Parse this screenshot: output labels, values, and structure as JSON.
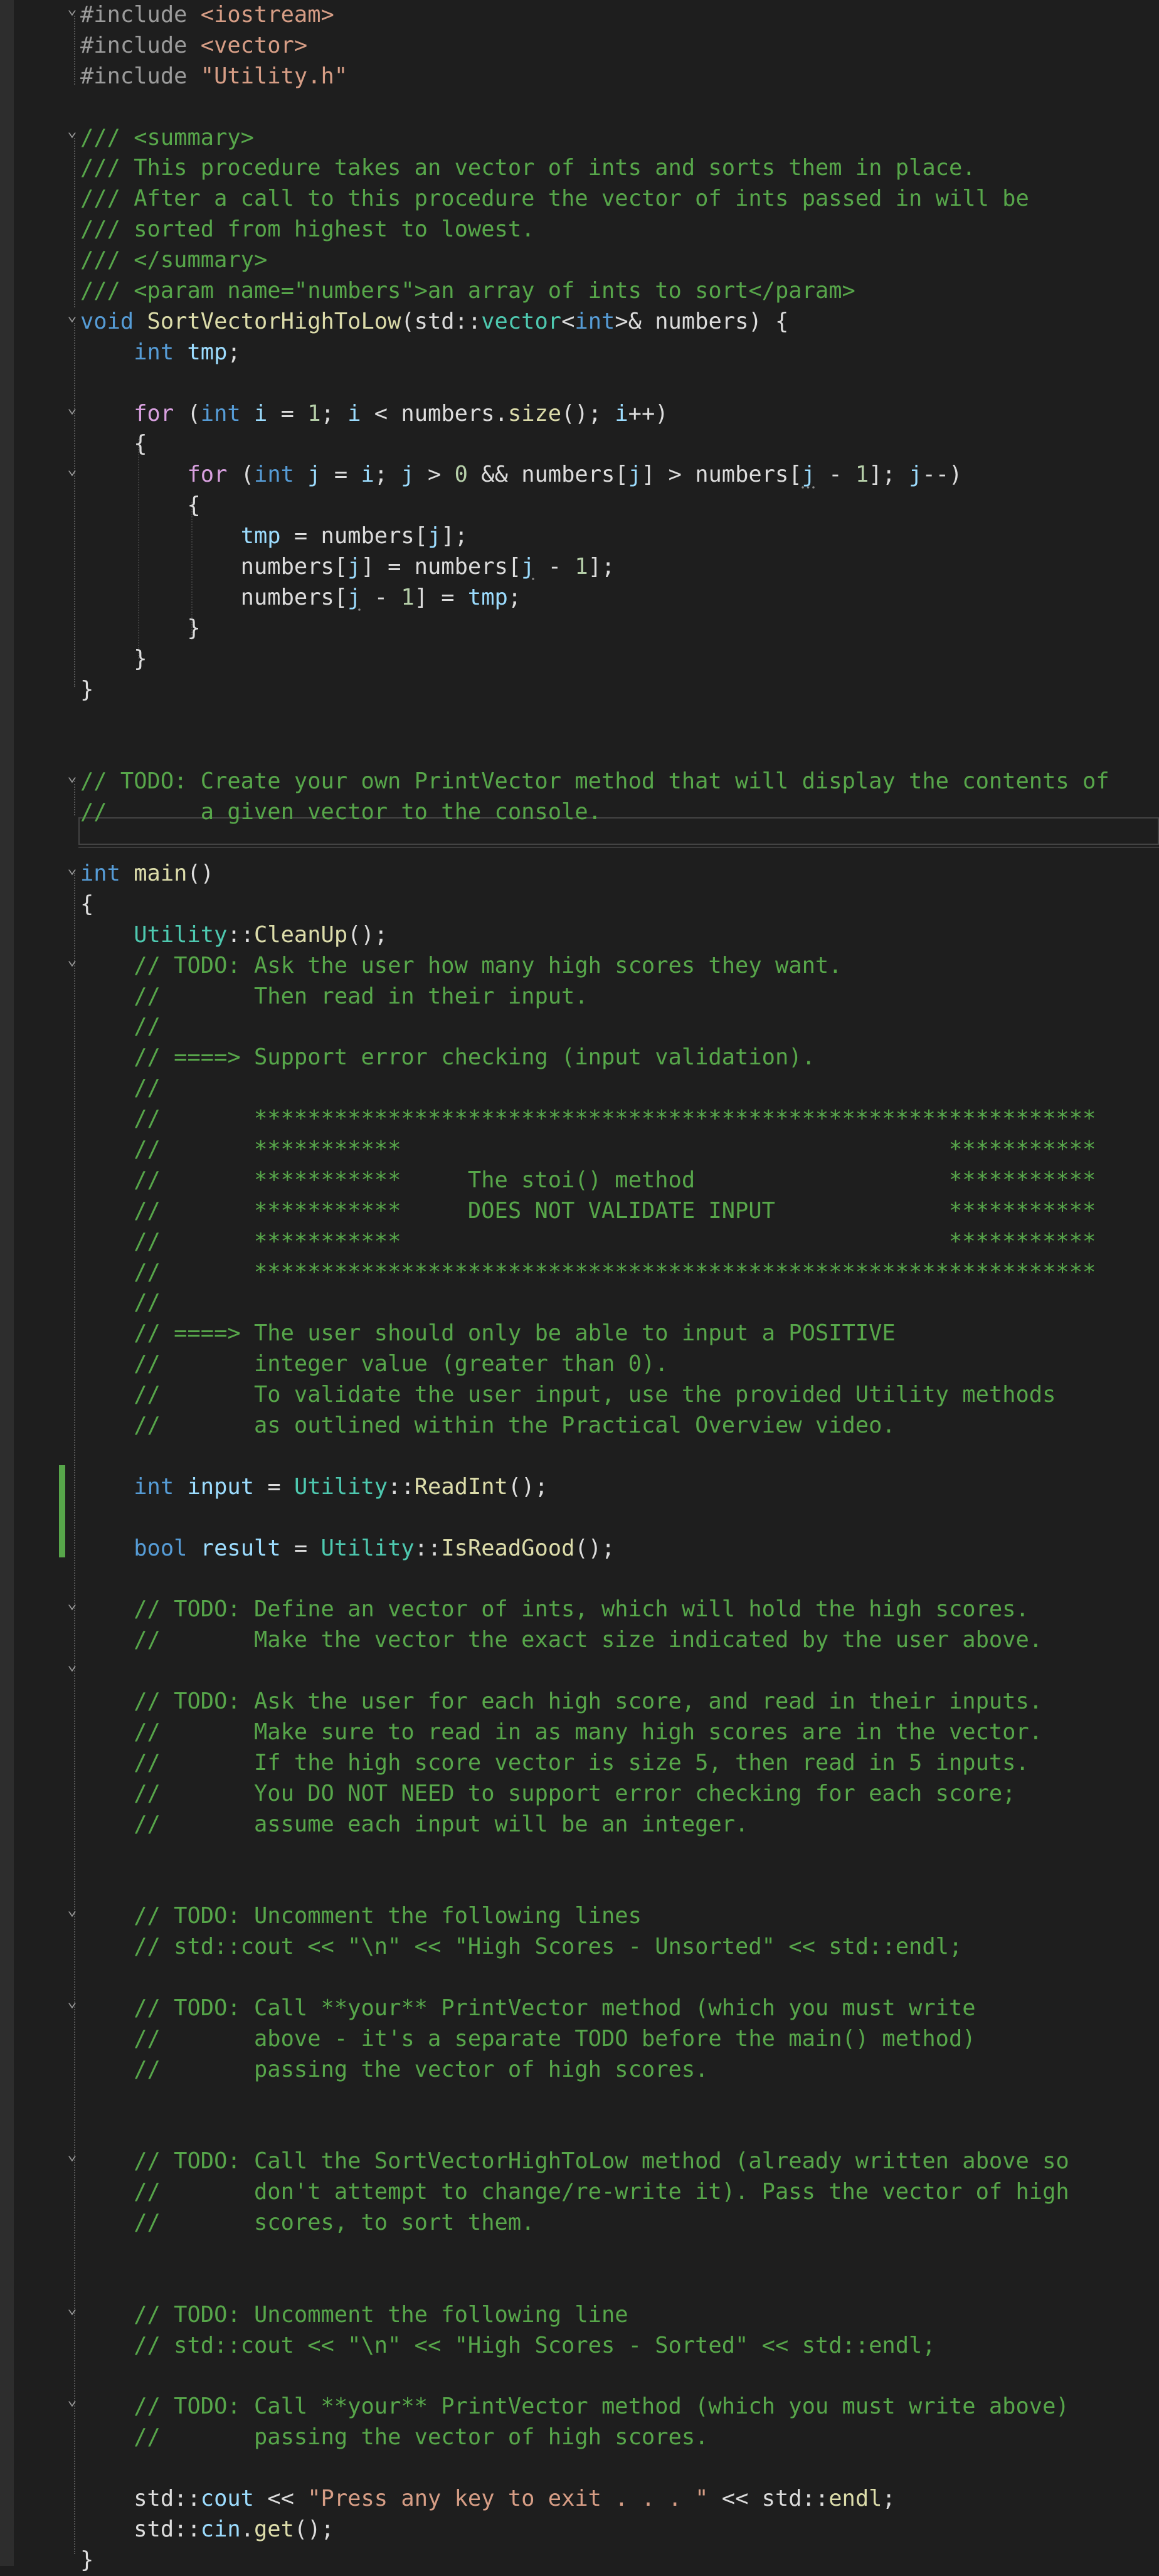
{
  "editor": {
    "language": "C++",
    "colors": {
      "background": "#1e1e1e",
      "keyword": "#569cd6",
      "comment": "#57a64a",
      "string": "#d69d85",
      "function": "#dcdcaa",
      "variable": "#9cdcfe",
      "type": "#4ec9b0",
      "number": "#b5cea8",
      "change_bar": "#57a64a"
    },
    "lines": [
      [
        [
          "pp",
          "#include "
        ],
        [
          "str",
          "<iostream>"
        ]
      ],
      [
        [
          "pp",
          "#include "
        ],
        [
          "str",
          "<vector>"
        ]
      ],
      [
        [
          "pp",
          "#include "
        ],
        [
          "str",
          "\"Utility.h\""
        ]
      ],
      [],
      [
        [
          "doc",
          "/// <summary>"
        ]
      ],
      [
        [
          "doc",
          "/// This procedure takes an vector of ints and sorts them in place."
        ]
      ],
      [
        [
          "doc",
          "/// After a call to this procedure the vector of ints passed in will be"
        ]
      ],
      [
        [
          "doc",
          "/// sorted from highest to lowest."
        ]
      ],
      [
        [
          "doc",
          "/// </summary>"
        ]
      ],
      [
        [
          "doc",
          "/// <param name=\"numbers\">an array of ints to sort</param>"
        ]
      ],
      [
        [
          "kw",
          "void "
        ],
        [
          "fn",
          "SortVectorHighToLow"
        ],
        [
          "text",
          "(std::"
        ],
        [
          "type",
          "vector"
        ],
        [
          "text",
          "<"
        ],
        [
          "kw",
          "int"
        ],
        [
          "text",
          ">& numbers) {"
        ]
      ],
      [
        [
          "text",
          "    "
        ],
        [
          "kw",
          "int "
        ],
        [
          "var",
          "tmp"
        ],
        [
          "text",
          ";"
        ]
      ],
      [],
      [
        [
          "text",
          "    "
        ],
        [
          "kw2",
          "for "
        ],
        [
          "text",
          "("
        ],
        [
          "kw",
          "int "
        ],
        [
          "var",
          "i"
        ],
        [
          "text",
          " = "
        ],
        [
          "num",
          "1"
        ],
        [
          "text",
          "; "
        ],
        [
          "var",
          "i"
        ],
        [
          "text",
          " < numbers."
        ],
        [
          "fn",
          "size"
        ],
        [
          "text",
          "(); "
        ],
        [
          "var",
          "i"
        ],
        [
          "text",
          "++)"
        ]
      ],
      [
        [
          "text",
          "    {"
        ]
      ],
      [
        [
          "text",
          "        "
        ],
        [
          "kw2",
          "for "
        ],
        [
          "text",
          "("
        ],
        [
          "kw",
          "int "
        ],
        [
          "var",
          "j"
        ],
        [
          "text",
          " = "
        ],
        [
          "var",
          "i"
        ],
        [
          "text",
          "; "
        ],
        [
          "var",
          "j"
        ],
        [
          "text",
          " > "
        ],
        [
          "num",
          "0"
        ],
        [
          "text",
          " && numbers["
        ],
        [
          "var",
          "j"
        ],
        [
          "text",
          "] > numbers["
        ],
        [
          "varsq",
          "j"
        ],
        [
          "text",
          " - "
        ],
        [
          "num",
          "1"
        ],
        [
          "text",
          "]; "
        ],
        [
          "var",
          "j"
        ],
        [
          "text",
          "--)"
        ]
      ],
      [
        [
          "text",
          "        {"
        ]
      ],
      [
        [
          "text",
          "            "
        ],
        [
          "var",
          "tmp"
        ],
        [
          "text",
          " = numbers["
        ],
        [
          "var",
          "j"
        ],
        [
          "text",
          "];"
        ]
      ],
      [
        [
          "text",
          "            numbers["
        ],
        [
          "var",
          "j"
        ],
        [
          "text",
          "] = numbers["
        ],
        [
          "varsq",
          "j"
        ],
        [
          "text",
          " - "
        ],
        [
          "num",
          "1"
        ],
        [
          "text",
          "];"
        ]
      ],
      [
        [
          "text",
          "            numbers["
        ],
        [
          "varsq",
          "j"
        ],
        [
          "text",
          " - "
        ],
        [
          "num",
          "1"
        ],
        [
          "text",
          "] = "
        ],
        [
          "var",
          "tmp"
        ],
        [
          "text",
          ";"
        ]
      ],
      [
        [
          "text",
          "        }"
        ]
      ],
      [
        [
          "text",
          "    }"
        ]
      ],
      [
        [
          "text",
          "}"
        ]
      ],
      [],
      [],
      [
        [
          "com",
          "// TODO: Create your own PrintVector method that will display the contents of"
        ]
      ],
      [
        [
          "com",
          "//       a given vector to the console."
        ]
      ],
      [],
      [
        [
          "kw",
          "int "
        ],
        [
          "fn",
          "main"
        ],
        [
          "text",
          "()"
        ]
      ],
      [
        [
          "text",
          "{"
        ]
      ],
      [
        [
          "text",
          "    "
        ],
        [
          "type",
          "Utility"
        ],
        [
          "text",
          "::"
        ],
        [
          "fn",
          "CleanUp"
        ],
        [
          "text",
          "();"
        ]
      ],
      [
        [
          "text",
          "    "
        ],
        [
          "com",
          "// TODO: Ask the user how many high scores they want."
        ]
      ],
      [
        [
          "text",
          "    "
        ],
        [
          "com",
          "//       Then read in their input."
        ]
      ],
      [
        [
          "text",
          "    "
        ],
        [
          "com",
          "//"
        ]
      ],
      [
        [
          "text",
          "    "
        ],
        [
          "com",
          "// ====> Support error checking (input validation)."
        ]
      ],
      [
        [
          "text",
          "    "
        ],
        [
          "com",
          "//"
        ]
      ],
      [
        [
          "text",
          "    "
        ],
        [
          "com",
          "//       ***************************************************************"
        ]
      ],
      [
        [
          "text",
          "    "
        ],
        [
          "com",
          "//       ***********                                         ***********"
        ]
      ],
      [
        [
          "text",
          "    "
        ],
        [
          "com",
          "//       ***********     The stoi() method                   ***********"
        ]
      ],
      [
        [
          "text",
          "    "
        ],
        [
          "com",
          "//       ***********     DOES NOT VALIDATE INPUT             ***********"
        ]
      ],
      [
        [
          "text",
          "    "
        ],
        [
          "com",
          "//       ***********                                         ***********"
        ]
      ],
      [
        [
          "text",
          "    "
        ],
        [
          "com",
          "//       ***************************************************************"
        ]
      ],
      [
        [
          "text",
          "    "
        ],
        [
          "com",
          "//"
        ]
      ],
      [
        [
          "text",
          "    "
        ],
        [
          "com",
          "// ====> The user should only be able to input a POSITIVE"
        ]
      ],
      [
        [
          "text",
          "    "
        ],
        [
          "com",
          "//       integer value (greater than 0)."
        ]
      ],
      [
        [
          "text",
          "    "
        ],
        [
          "com",
          "//       To validate the user input, use the provided Utility methods"
        ]
      ],
      [
        [
          "text",
          "    "
        ],
        [
          "com",
          "//       as outlined within the Practical Overview video."
        ]
      ],
      [],
      [
        [
          "text",
          "    "
        ],
        [
          "kw",
          "int "
        ],
        [
          "var",
          "input"
        ],
        [
          "text",
          " = "
        ],
        [
          "type",
          "Utility"
        ],
        [
          "text",
          "::"
        ],
        [
          "fn",
          "ReadInt"
        ],
        [
          "text",
          "();"
        ]
      ],
      [],
      [
        [
          "text",
          "    "
        ],
        [
          "kw",
          "bool "
        ],
        [
          "var",
          "result"
        ],
        [
          "text",
          " = "
        ],
        [
          "type",
          "Utility"
        ],
        [
          "text",
          "::"
        ],
        [
          "fn",
          "IsReadGood"
        ],
        [
          "text",
          "();"
        ]
      ],
      [],
      [
        [
          "text",
          "    "
        ],
        [
          "com",
          "// TODO: Define an vector of ints, which will hold the high scores."
        ]
      ],
      [
        [
          "text",
          "    "
        ],
        [
          "com",
          "//       Make the vector the exact size indicated by the user above."
        ]
      ],
      [],
      [
        [
          "text",
          "    "
        ],
        [
          "com",
          "// TODO: Ask the user for each high score, and read in their inputs."
        ]
      ],
      [
        [
          "text",
          "    "
        ],
        [
          "com",
          "//       Make sure to read in as many high scores are in the vector."
        ]
      ],
      [
        [
          "text",
          "    "
        ],
        [
          "com",
          "//       If the high score vector is size 5, then read in 5 inputs."
        ]
      ],
      [
        [
          "text",
          "    "
        ],
        [
          "com",
          "//       You DO NOT NEED to support error checking for each score;"
        ]
      ],
      [
        [
          "text",
          "    "
        ],
        [
          "com",
          "//       assume each input will be an integer."
        ]
      ],
      [],
      [],
      [
        [
          "text",
          "    "
        ],
        [
          "com",
          "// TODO: Uncomment the following lines"
        ]
      ],
      [
        [
          "text",
          "    "
        ],
        [
          "com",
          "// std::cout << \"\\n\" << \"High Scores - Unsorted\" << std::endl;"
        ]
      ],
      [],
      [
        [
          "text",
          "    "
        ],
        [
          "com",
          "// TODO: Call **your** PrintVector method (which you must write"
        ]
      ],
      [
        [
          "text",
          "    "
        ],
        [
          "com",
          "//       above - it's a separate TODO before the main() method)"
        ]
      ],
      [
        [
          "text",
          "    "
        ],
        [
          "com",
          "//       passing the vector of high scores."
        ]
      ],
      [],
      [],
      [
        [
          "text",
          "    "
        ],
        [
          "com",
          "// TODO: Call the SortVectorHighToLow method (already written above so"
        ]
      ],
      [
        [
          "text",
          "    "
        ],
        [
          "com",
          "//       don't attempt to change/re-write it). Pass the vector of high"
        ]
      ],
      [
        [
          "text",
          "    "
        ],
        [
          "com",
          "//       scores, to sort them."
        ]
      ],
      [],
      [],
      [
        [
          "text",
          "    "
        ],
        [
          "com",
          "// TODO: Uncomment the following line"
        ]
      ],
      [
        [
          "text",
          "    "
        ],
        [
          "com",
          "// std::cout << \"\\n\" << \"High Scores - Sorted\" << std::endl;"
        ]
      ],
      [],
      [
        [
          "text",
          "    "
        ],
        [
          "com",
          "// TODO: Call **your** PrintVector method (which you must write above)"
        ]
      ],
      [
        [
          "text",
          "    "
        ],
        [
          "com",
          "//       passing the vector of high scores."
        ]
      ],
      [],
      [
        [
          "text",
          "    std::"
        ],
        [
          "var",
          "cout"
        ],
        [
          "text",
          " << "
        ],
        [
          "str",
          "\"Press any key to exit . . . \""
        ],
        [
          "text",
          " << std::"
        ],
        [
          "fn",
          "endl"
        ],
        [
          "text",
          ";"
        ]
      ],
      [
        [
          "text",
          "    std::"
        ],
        [
          "var",
          "cin"
        ],
        [
          "text",
          "."
        ],
        [
          "fn",
          "get"
        ],
        [
          "text",
          "();"
        ]
      ],
      [
        [
          "text",
          "}"
        ]
      ]
    ]
  }
}
